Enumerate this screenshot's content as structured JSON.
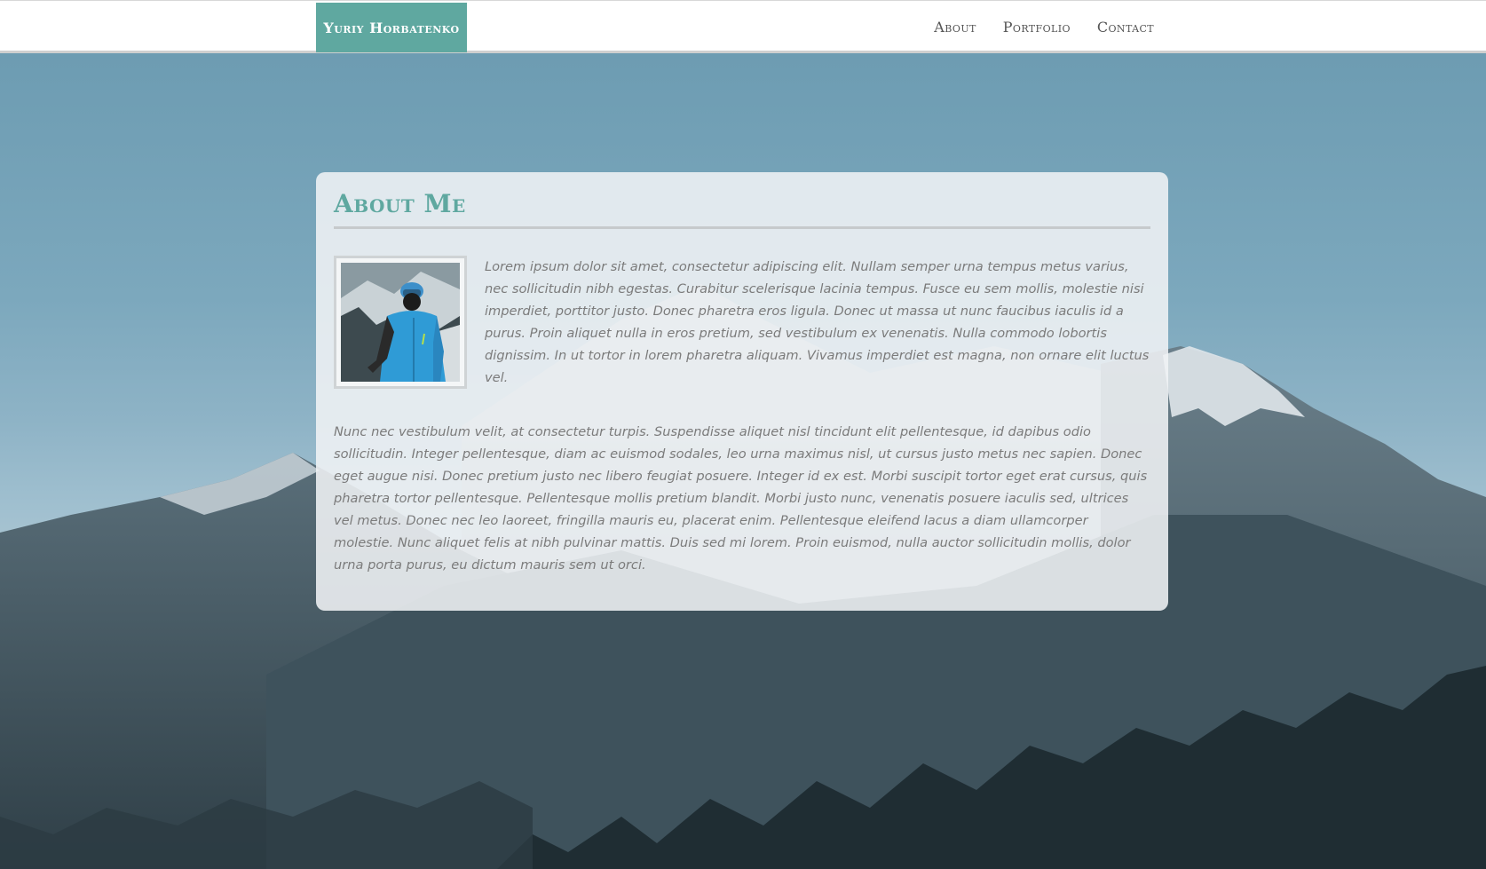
{
  "navbar": {
    "brand": "Yuriy Horbatenko",
    "links": [
      "About",
      "Portfolio",
      "Contact"
    ]
  },
  "about": {
    "title": "About Me",
    "paragraph1": "Lorem ipsum dolor sit amet, consectetur adipiscing elit. Nullam semper urna tempus metus varius, nec sollicitudin nibh egestas. Curabitur scelerisque lacinia tempus. Fusce eu sem mollis, molestie nisi imperdiet, porttitor justo. Donec pharetra eros ligula. Donec ut massa ut nunc faucibus iaculis id a purus. Proin aliquet nulla in eros pretium, sed vestibulum ex venenatis. Nulla commodo lobortis dignissim. In ut tortor in lorem pharetra aliquam. Vivamus imperdiet est magna, non ornare elit luctus vel.",
    "paragraph2": "Nunc nec vestibulum velit, at consectetur turpis. Suspendisse aliquet nisl tincidunt elit pellentesque, id dapibus odio sollicitudin. Integer pellentesque, diam ac euismod sodales, leo urna maximus nisl, ut cursus justo metus nec sapien. Donec eget augue nisi. Donec pretium justo nec libero feugiat posuere. Integer id ex est. Morbi suscipit tortor eget erat cursus, quis pharetra tortor pellentesque. Pellentesque mollis pretium blandit. Morbi justo nunc, venenatis posuere iaculis sed, ultrices vel metus. Donec nec leo laoreet, fringilla mauris eu, placerat enim. Pellentesque eleifend lacus a diam ullamcorper molestie. Nunc aliquet felis at nibh pulvinar mattis. Duis sed mi lorem. Proin euismod, nulla auctor sollicitudin mollis, dolor urna porta purus, eu dictum mauris sem ut orci."
  },
  "colors": {
    "accent": "#5fa8a0",
    "body_text": "#7b7b7b",
    "nav_text": "#555555"
  }
}
